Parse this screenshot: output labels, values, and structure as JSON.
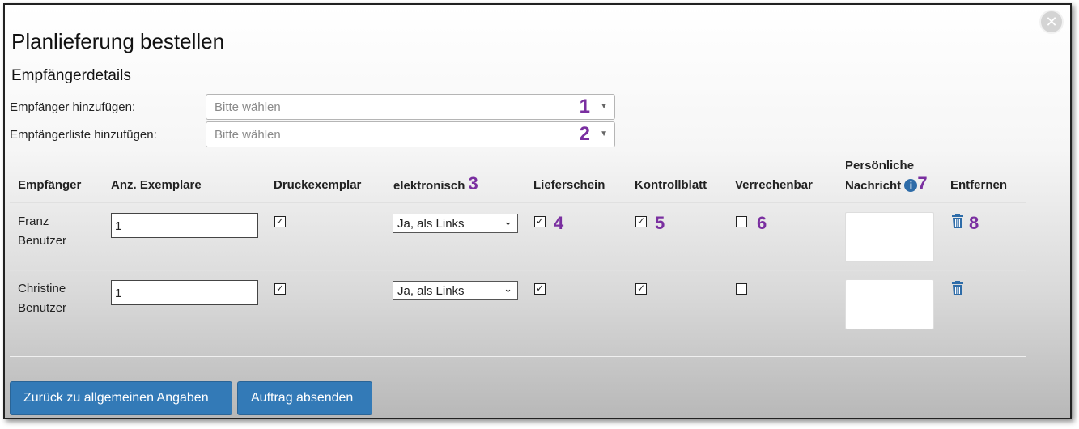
{
  "dialog": {
    "close_icon": "close-icon",
    "title": "Planlieferung bestellen",
    "subtitle": "Empfängerdetails"
  },
  "fields": [
    {
      "label": "Empfänger hinzufügen:",
      "placeholder": "Bitte wählen",
      "marker": "1"
    },
    {
      "label": "Empfängerliste hinzufügen:",
      "placeholder": "Bitte wählen",
      "marker": "2"
    }
  ],
  "table": {
    "headers": {
      "recipient": "Empfänger",
      "copies": "Anz. Exemplare",
      "print": "Druckexemplar",
      "electronic": "elektronisch",
      "electronic_marker": "3",
      "delivery": "Lieferschein",
      "control": "Kontrollblatt",
      "billable": "Verrechenbar",
      "message_line1": "Persönliche",
      "message_line2": "Nachricht",
      "message_marker": "7",
      "remove": "Entfernen"
    },
    "rows": [
      {
        "first": "Franz",
        "last": "Benutzer",
        "copies": "1",
        "print": true,
        "electronic": "Ja, als Links",
        "delivery": true,
        "control": true,
        "billable": false,
        "markers": {
          "delivery": "4",
          "control": "5",
          "billable": "6",
          "remove": "8"
        }
      },
      {
        "first": "Christine",
        "last": "Benutzer",
        "copies": "1",
        "print": true,
        "electronic": "Ja, als Links",
        "delivery": true,
        "control": true,
        "billable": false
      }
    ]
  },
  "buttons": {
    "back": "Zurück zu allgemeinen Angaben",
    "submit": "Auftrag absenden"
  },
  "colors": {
    "accent": "#337ab7",
    "marker": "#7a2fa0"
  },
  "icons": {
    "info": "info-icon",
    "trash": "trash-icon",
    "caret": "chevron-down-icon"
  }
}
